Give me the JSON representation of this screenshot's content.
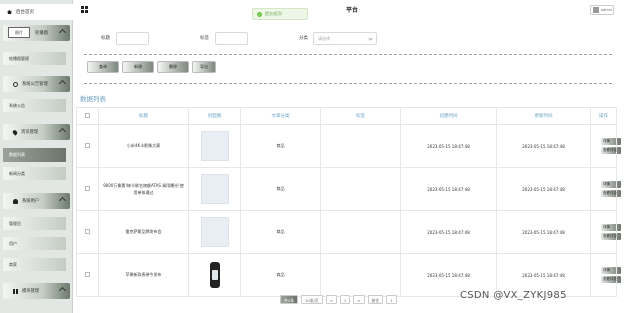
{
  "sidebar": {
    "home_label": "后台首页",
    "logo_text": "图片",
    "menus": [
      {
        "label": "轮播图",
        "icon": "image-icon"
      },
      {
        "label": "系统公告管理",
        "icon": "info-icon"
      },
      {
        "label": "资讯管理",
        "icon": "pin-icon"
      },
      {
        "label": "系统用户",
        "icon": "user-icon"
      },
      {
        "label": "模块管理",
        "icon": "grid-icon"
      }
    ],
    "subs": [
      "轮播图管理",
      "系统公告",
      "数据列表",
      "新闻分类",
      "管理员",
      "用户",
      "商家"
    ]
  },
  "header": {
    "title": "平台",
    "toast": "提交成功!",
    "user": "admin"
  },
  "search": {
    "title_label": "标题",
    "tag_label": "标签",
    "category_label": "分类",
    "category_placeholder": "请选择"
  },
  "toolbar": {
    "query": "查询",
    "add": "新增",
    "delete": "删除",
    "export": "导出"
  },
  "list_title": "数据列表",
  "table": {
    "columns": [
      "标题",
      "封面图",
      "文章分类",
      "标签",
      "创建时间",
      "更新时间",
      "操作"
    ],
    "rows": [
      {
        "title": "小米4K卡影像大赛",
        "category": "商品",
        "tag": "",
        "created": "2023-05-15 18:47:48",
        "updated": "2023-05-15 18:47:48"
      },
      {
        "title": "9000万像素!徕卡联名旗舰ATAS 调用曝光!使用单体通过",
        "category": "商品",
        "tag": "",
        "created": "2023-05-15 18:47:48",
        "updated": "2023-05-15 18:47:48"
      },
      {
        "title": "雷克萨斯品牌发布会",
        "category": "商品",
        "tag": "",
        "created": "2023-05-15 18:47:48",
        "updated": "2023-05-15 18:47:48"
      },
      {
        "title": "苹果新款表带今发布",
        "category": "商品",
        "tag": "",
        "created": "2023-05-15 18:47:48",
        "updated": "2023-05-15 18:47:48"
      }
    ],
    "actions": {
      "detail": "详情",
      "edit": "查看评论"
    }
  },
  "pager": {
    "total": "共4条",
    "page_size": "10条/页",
    "prev": "<",
    "current": "1",
    "next": ">",
    "goto": "前往",
    "goto_page": "1"
  },
  "watermark": "CSDN @VX_ZYKJ985"
}
